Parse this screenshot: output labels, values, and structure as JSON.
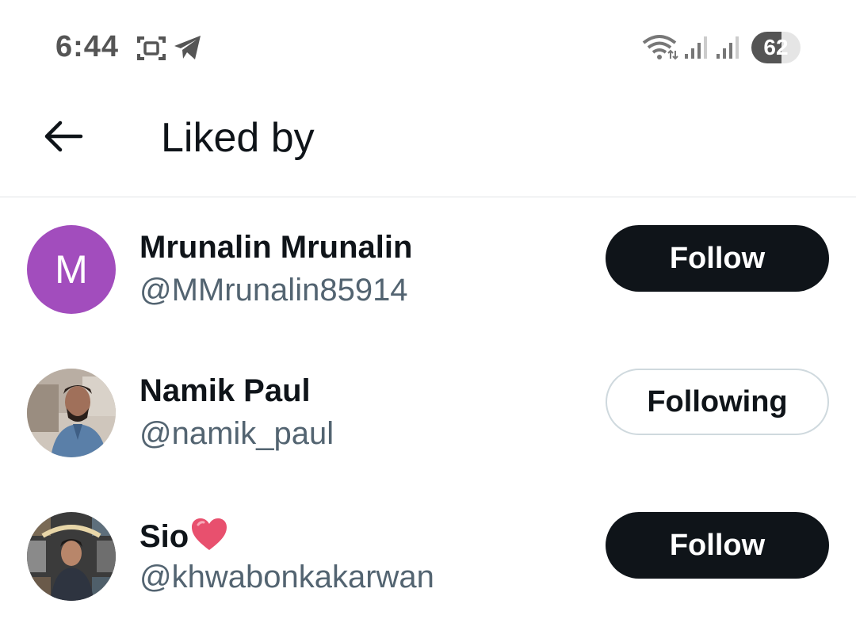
{
  "status_bar": {
    "time": "6:44",
    "battery_level": "62",
    "battery_fraction": 0.62,
    "icons": [
      "screenshot-icon",
      "telegram-icon",
      "wifi-icon",
      "signal-icon",
      "signal-icon",
      "battery-icon"
    ]
  },
  "header": {
    "back_icon": "arrow-left-icon",
    "title": "Liked by"
  },
  "users": [
    {
      "name": "Mrunalin Mrunalin",
      "handle": "@MMrunalin85914",
      "avatar_letter": "M",
      "avatar_color": "#a24dbd",
      "button": "Follow",
      "following": false
    },
    {
      "name": "Namik Paul",
      "handle": "@namik_paul",
      "button": "Following",
      "following": true
    },
    {
      "name": "Sio",
      "name_emoji": "heart-icon",
      "handle": "@khwabonkakarwan",
      "button": "Follow",
      "following": false
    }
  ],
  "colors": {
    "primary_text": "#0f1419",
    "secondary_text": "#536471",
    "follow_button_bg": "#0f1419",
    "divider": "#e1e4e6"
  }
}
